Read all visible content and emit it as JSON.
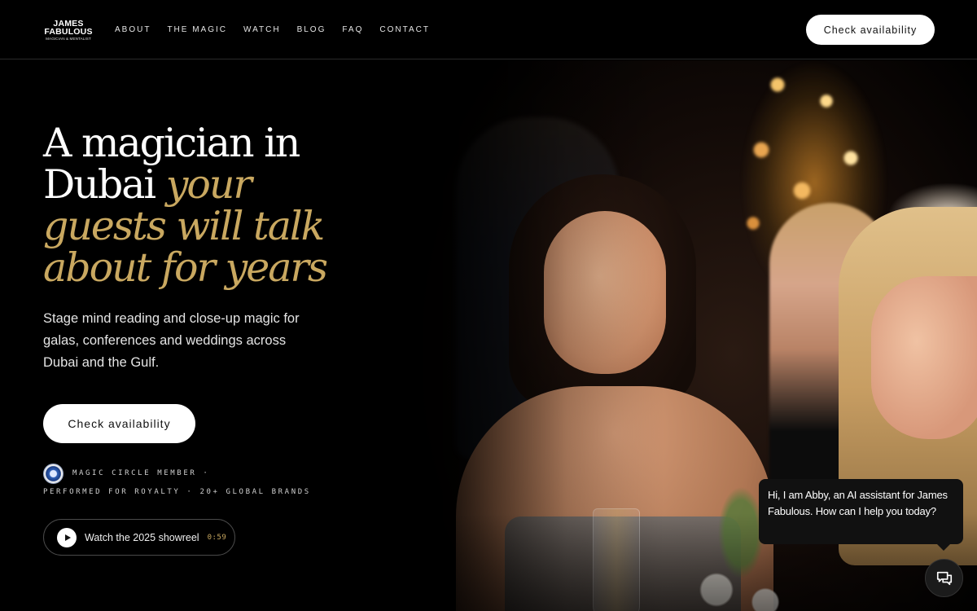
{
  "brand": {
    "name_line1": "JAMES",
    "name_line2": "FABULOUS",
    "tagline": "MAGICIAN & MENTALIST"
  },
  "nav": {
    "items": [
      "ABOUT",
      "THE MAGIC",
      "WATCH",
      "BLOG",
      "FAQ",
      "CONTACT"
    ]
  },
  "header": {
    "cta_label": "Check availability"
  },
  "hero": {
    "headline_plain": "A magician in Dubai",
    "headline_gold": "your guests will talk about for years",
    "subtitle": "Stage mind reading and close-up magic for galas, conferences and weddings across Dubai and the Gulf.",
    "cta_label": "Check availability",
    "credentials_line1": "MAGIC CIRCLE MEMBER ·",
    "credentials_line2": "PERFORMED FOR ROYALTY · 20+ GLOBAL BRANDS",
    "showreel_label": "Watch the 2025 showreel",
    "showreel_duration": "0:59"
  },
  "chat": {
    "message": "Hi, I am Abby, an AI assistant for James Fabulous. How can I help you today?"
  },
  "colors": {
    "background": "#000000",
    "accent_gold": "#c9a860",
    "button": "#ffffff"
  },
  "icons": {
    "showreel": "play-icon",
    "chat": "chat-icon",
    "badge": "magic-circle-seal-icon"
  }
}
